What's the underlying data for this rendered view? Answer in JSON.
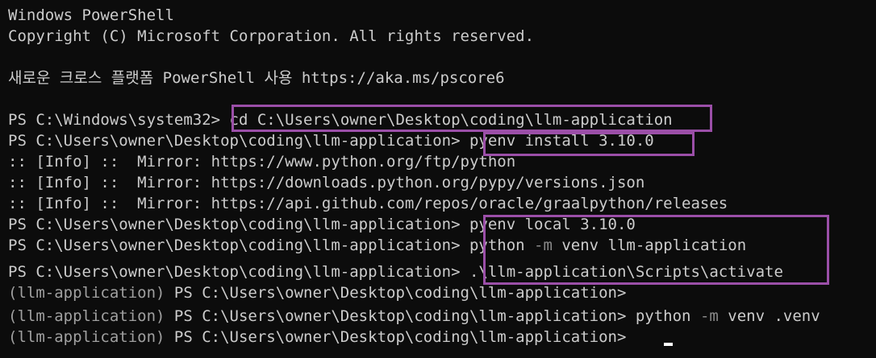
{
  "lines": {
    "l1": "Windows PowerShell",
    "l2": "Copyright (C) Microsoft Corporation. All rights reserved.",
    "l3": "새로운 크로스 플랫폼 PowerShell 사용 https://aka.ms/pscore6",
    "l4_prompt": "PS C:\\Windows\\system32>",
    "l4_cmd": " cd C:\\Users\\owner\\Desktop\\coding\\llm-application",
    "l5_prompt": "PS C:\\Users\\owner\\Desktop\\coding\\llm-application>",
    "l5_cmd": " pyenv install 3.10.0",
    "l6": ":: [Info] ::  Mirror: https://www.python.org/ftp/python",
    "l7": ":: [Info] ::  Mirror: https://downloads.python.org/pypy/versions.json",
    "l8": ":: [Info] ::  Mirror: https://api.github.com/repos/oracle/graalpython/releases",
    "l9_prompt": "PS C:\\Users\\owner\\Desktop\\coding\\llm-application>",
    "l9_cmd": " pyenv local 3.10.0",
    "l10_prompt": "PS C:\\Users\\owner\\Desktop\\coding\\llm-application>",
    "l10_cmd_a": " python",
    "l10_cmd_flag": " -m",
    "l10_cmd_b": " venv llm-application",
    "l11_prompt": "PS C:\\Users\\owner\\Desktop\\coding\\llm-application>",
    "l11_cmd": " .\\llm-application\\Scripts\\activate",
    "l12_env": "(llm-application)",
    "l12_prompt": " PS C:\\Users\\owner\\Desktop\\coding\\llm-application>",
    "l13_env": "(llm-application)",
    "l13_prompt": " PS C:\\Users\\owner\\Desktop\\coding\\llm-application>",
    "l13_cmd_a": " python",
    "l13_cmd_flag": " -m",
    "l13_cmd_b": " venv .venv",
    "l14_env": "(llm-application)",
    "l14_prompt": " PS C:\\Users\\owner\\Desktop\\coding\\llm-application>"
  },
  "colors": {
    "background": "#0c0c0c",
    "text": "#cccccc",
    "highlight_box": "#9b4fa8"
  }
}
